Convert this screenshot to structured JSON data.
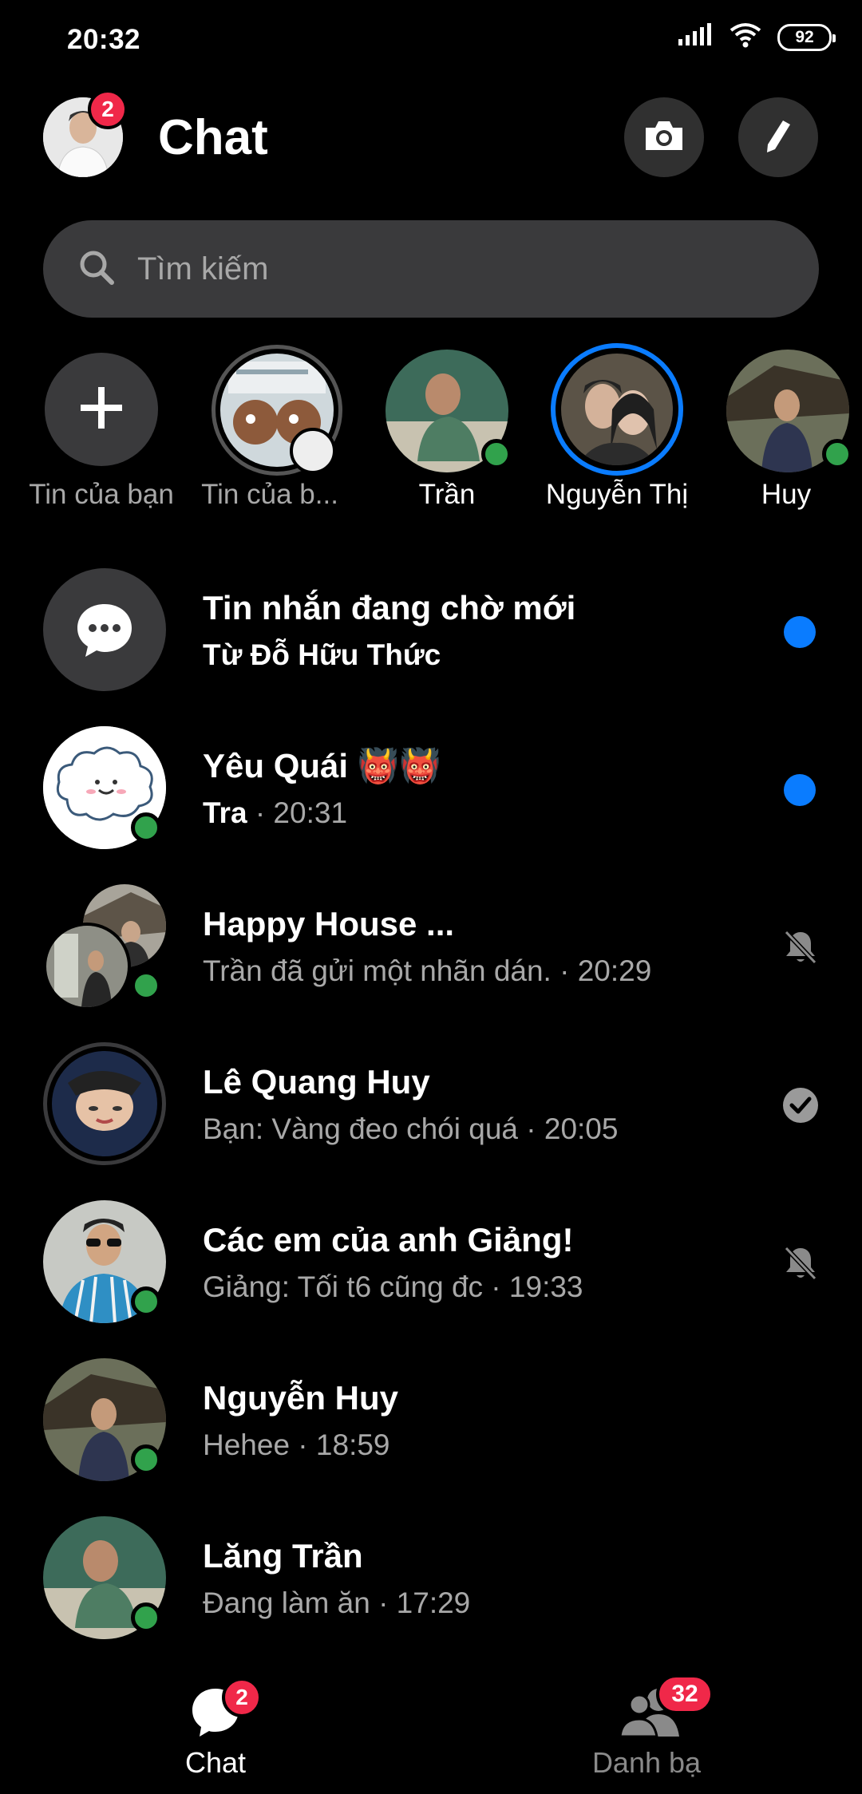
{
  "status_bar": {
    "time": "20:32",
    "battery": "92"
  },
  "header": {
    "title": "Chat",
    "avatar_badge": "2"
  },
  "search": {
    "placeholder": "Tìm kiếm"
  },
  "stories": [
    {
      "label": "Tin của bạn"
    },
    {
      "label": "Tin của b..."
    },
    {
      "label": "Trần"
    },
    {
      "label": "Nguyễn Thị"
    },
    {
      "label": "Huy"
    }
  ],
  "chats": [
    {
      "title": "Tin nhắn đang chờ mới",
      "subtitle": "Từ Đỗ Hữu Thức",
      "indicator": "unread"
    },
    {
      "title": "Yêu Quái 👹👹",
      "sender": "Tra",
      "time_suffix": " · 20:31",
      "indicator": "unread"
    },
    {
      "title": "Happy House ...",
      "subtitle": "Trần đã gửi một nhãn dán. · 20:29",
      "indicator": "muted"
    },
    {
      "title": "Lê Quang Huy",
      "subtitle": "Bạn: Vàng đeo chói quá · 20:05",
      "indicator": "seen"
    },
    {
      "title": "Các em của anh Giảng!",
      "subtitle": "Giảng: Tối t6 cũng đc · 19:33",
      "indicator": "muted"
    },
    {
      "title": "Nguyễn Huy",
      "subtitle": "Hehee · 18:59",
      "indicator": "none"
    },
    {
      "title": "Lăng Trần",
      "subtitle": "Đang làm ăn · 17:29",
      "indicator": "none"
    }
  ],
  "bottom_nav": [
    {
      "label": "Chat",
      "badge": "2"
    },
    {
      "label": "Danh bạ",
      "badge": "32"
    }
  ],
  "colors": {
    "accent": "#0a7cff",
    "online": "#31a24c",
    "badge": "#f02849",
    "muted_text": "#a8a8a8"
  }
}
